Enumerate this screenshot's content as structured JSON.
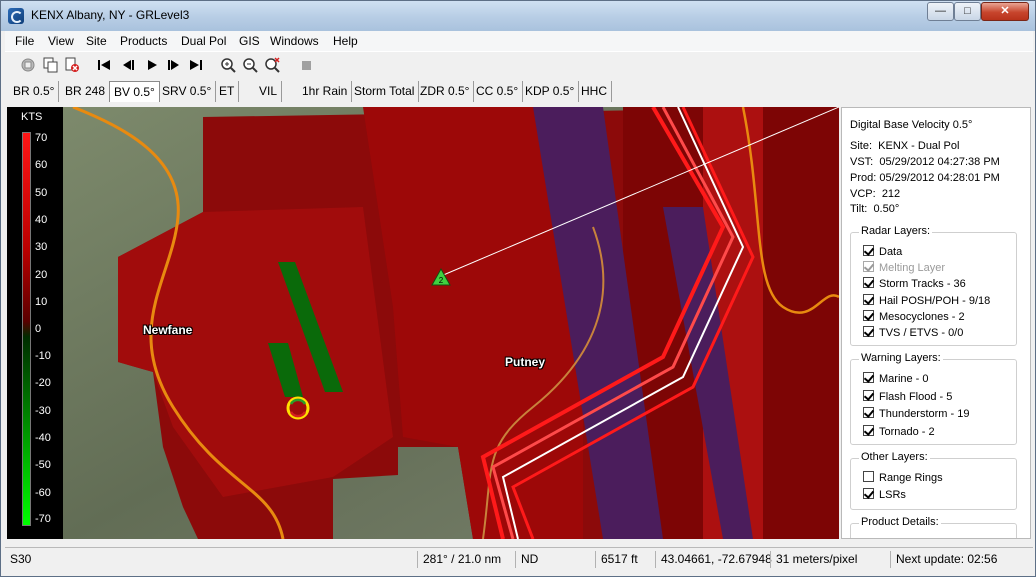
{
  "window": {
    "title": "KENX Albany, NY - GRLevel3"
  },
  "menu": [
    "File",
    "View",
    "Site",
    "Products",
    "Dual Pol",
    "GIS",
    "Windows",
    "Help"
  ],
  "toolbar_icons": [
    "copy-icon",
    "duplicate-icon",
    "delete-icon",
    "first-frame-icon",
    "previous-frame-icon",
    "play-icon",
    "next-frame-icon",
    "last-frame-icon",
    "zoom-in-icon",
    "zoom-out-icon",
    "clear-zoom-icon",
    "stop-icon"
  ],
  "tabs": [
    {
      "label": "BR 0.5°"
    },
    {
      "label": "BR 248"
    },
    {
      "label": "BV 0.5°"
    },
    {
      "label": "SRV 0.5°"
    },
    {
      "label": "ET"
    },
    {
      "label": "VIL"
    },
    {
      "label": "1hr Rain"
    },
    {
      "label": "Storm Total"
    },
    {
      "label": "ZDR 0.5°"
    },
    {
      "label": "CC 0.5°"
    },
    {
      "label": "KDP 0.5°"
    },
    {
      "label": "HHC"
    }
  ],
  "active_tab": "BV 0.5°",
  "legend": {
    "unit": "KTS",
    "ticks": [
      "70",
      "60",
      "50",
      "40",
      "30",
      "20",
      "10",
      "0",
      "-10",
      "-20",
      "-30",
      "-40",
      "-50",
      "-60",
      "-70"
    ]
  },
  "map": {
    "labels": {
      "newfane": "Newfane",
      "putney": "Putney"
    },
    "storm_cell_marker": "2",
    "colors": {
      "inbound": "#0a6a0a",
      "outbound": "#8c0a0a",
      "range_folded": "#4b1d5c",
      "warning_polygon": "#ff1a1a",
      "county_road": "#e88a10"
    }
  },
  "product": {
    "heading": "Digital Base Velocity 0.5°",
    "site_label": "Site:",
    "site_value": "KENX - Dual Pol",
    "vst_label": "VST:",
    "vst_value": "05/29/2012  04:27:38 PM",
    "prod_label": "Prod:",
    "prod_value": "05/29/2012  04:28:01 PM",
    "vcp_label": "VCP:",
    "vcp_value": "212",
    "tilt_label": "Tilt:",
    "tilt_value": "0.50°"
  },
  "radar_layers": {
    "title": "Radar Layers:",
    "items": [
      {
        "label": "Data",
        "checked": true,
        "enabled": true
      },
      {
        "label": "Melting Layer",
        "checked": true,
        "enabled": false
      },
      {
        "label": "Storm Tracks - 36",
        "checked": true,
        "enabled": true
      },
      {
        "label": "Hail POSH/POH - 9/18",
        "checked": true,
        "enabled": true
      },
      {
        "label": "Mesocyclones - 2",
        "checked": true,
        "enabled": true
      },
      {
        "label": "TVS / ETVS - 0/0",
        "checked": true,
        "enabled": true
      }
    ]
  },
  "warning_layers": {
    "title": "Warning Layers:",
    "items": [
      {
        "label": "Marine - 0",
        "checked": true
      },
      {
        "label": "Flash Flood - 5",
        "checked": true
      },
      {
        "label": "Thunderstorm - 19",
        "checked": true
      },
      {
        "label": "Tornado - 2",
        "checked": true
      }
    ]
  },
  "other_layers": {
    "title": "Other Layers:",
    "items": [
      {
        "label": "Range Rings",
        "checked": false
      },
      {
        "label": "LSRs",
        "checked": true
      }
    ]
  },
  "product_details": {
    "title": "Product Details:"
  },
  "status": {
    "bin": "S30",
    "azimuth_range": "281° / 21.0 nm",
    "value": "ND",
    "height": "6517 ft",
    "coords": "43.04661, -72.67948",
    "resolution": "31 meters/pixel",
    "next_update": "Next update: 02:56"
  }
}
